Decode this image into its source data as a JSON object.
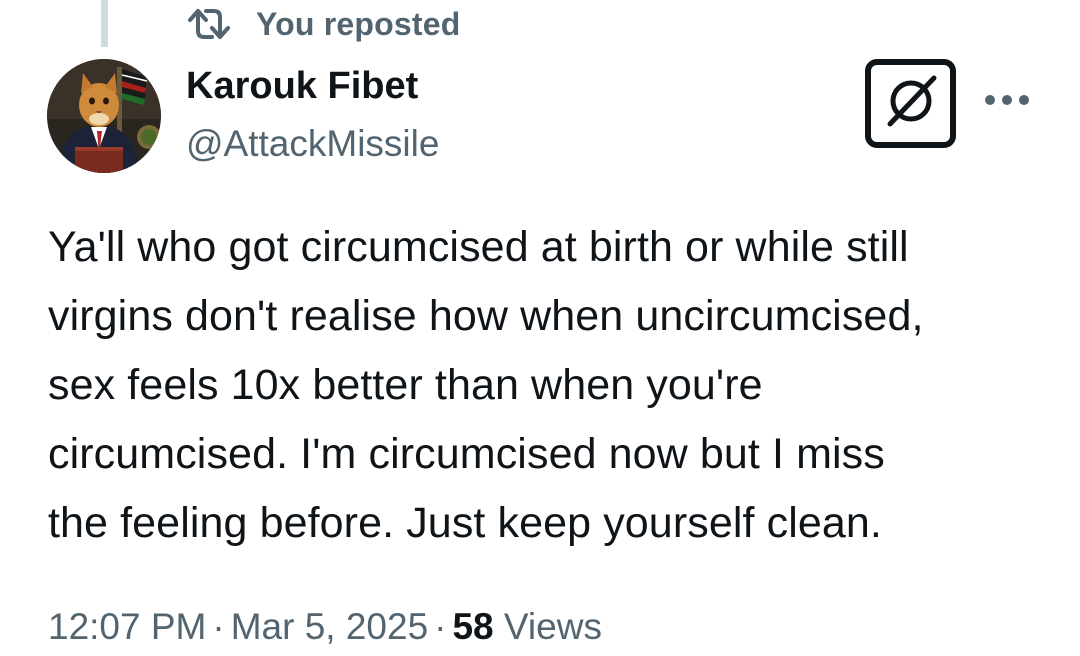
{
  "social_context": {
    "icon": "repost-icon",
    "text": "You reposted"
  },
  "author": {
    "avatar_icon": "avatar",
    "display_name": "Karouk Fibet",
    "handle": "@AttackMissile"
  },
  "actions": {
    "grok_icon": "grok-icon",
    "more_icon": "more-icon"
  },
  "tweet": {
    "text": "Ya'll who got circumcised at birth or while still\nvirgins don't realise how when uncircumcised,\nsex feels 10x better than when you're\ncircumcised. I'm circumcised now but I miss\nthe feeling before. Just keep yourself clean.",
    "time": "12:07 PM",
    "separator": "·",
    "date": "Mar 5, 2025",
    "views_count": "58",
    "views_label": "Views"
  },
  "colors": {
    "text_primary": "#0f1419",
    "text_secondary": "#536471",
    "thread_line": "#cfd9de"
  }
}
